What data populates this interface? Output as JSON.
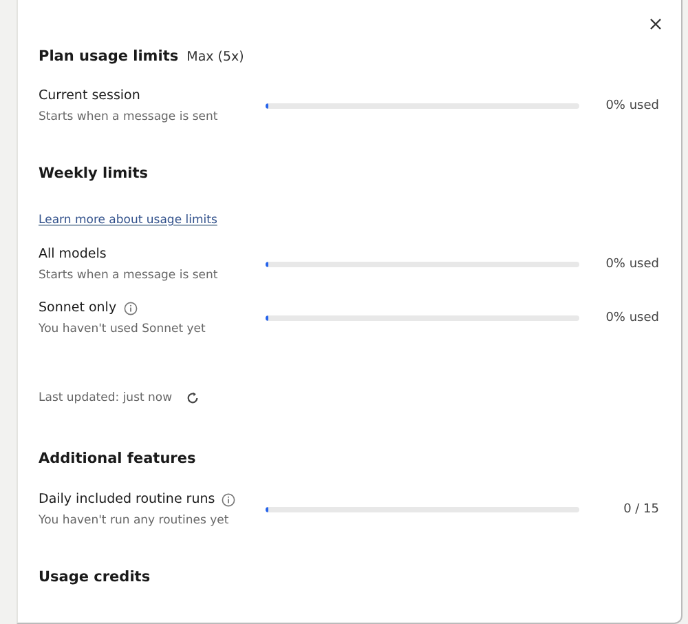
{
  "title": "Plan usage limits",
  "plan": "Max (5x)",
  "blocks": [
    {
      "kind": "limit",
      "label": "Current session",
      "info": false,
      "note": "Starts when a message is sent",
      "level": 0,
      "reading": "0% used"
    },
    {
      "kind": "heading",
      "text": "Weekly limits"
    },
    {
      "kind": "link",
      "text": "Learn more about usage limits"
    },
    {
      "kind": "limit",
      "label": "All models",
      "info": false,
      "note": "Starts when a message is sent",
      "level": 0,
      "reading": "0% used"
    },
    {
      "kind": "limit",
      "label": "Sonnet only",
      "info": true,
      "note": "You haven't used Sonnet yet",
      "level": 0,
      "reading": "0% used"
    },
    {
      "kind": "updated",
      "text": "Last updated: just now"
    },
    {
      "kind": "heading",
      "text": "Additional features"
    },
    {
      "kind": "limit",
      "label": "Daily included routine runs",
      "info": true,
      "note": "You haven't run any routines yet",
      "level": 0,
      "reading": "0 / 15"
    },
    {
      "kind": "heading",
      "text": "Usage credits"
    }
  ]
}
